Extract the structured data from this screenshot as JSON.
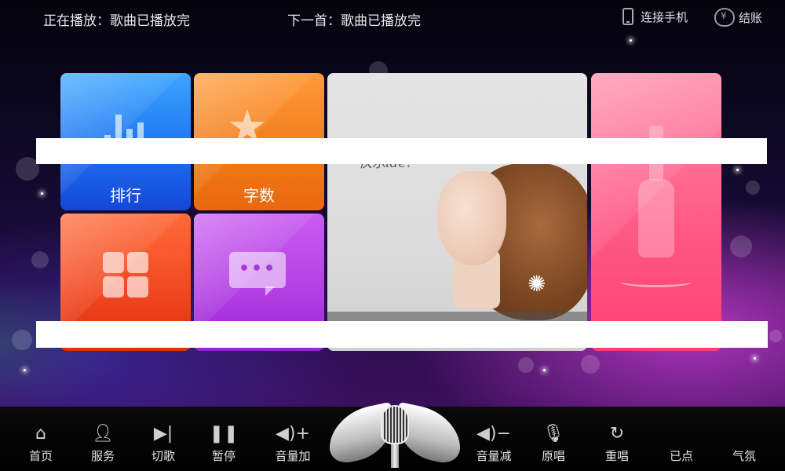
{
  "topbar": {
    "now_playing": "正在播放：歌曲已播放完",
    "next_song": "下一首：歌曲已播放完",
    "connect_phone": "连接手机",
    "checkout": "结账"
  },
  "tiles": {
    "rank_label": "排行",
    "count_label": "字数",
    "photo_script": "快乐ide?"
  },
  "controls": [
    {
      "label": "首页",
      "icon": "home-icon"
    },
    {
      "label": "服务",
      "icon": "person-icon"
    },
    {
      "label": "切歌",
      "icon": "skip-icon"
    },
    {
      "label": "暂停",
      "icon": "pause-icon"
    },
    {
      "label": "音量加",
      "icon": "volume-up-icon"
    },
    {
      "label": "音量减",
      "icon": "volume-down-icon"
    },
    {
      "label": "原唱",
      "icon": "mute-mic-icon"
    },
    {
      "label": "重唱",
      "icon": "replay-icon"
    },
    {
      "label": "已点",
      "icon": ""
    },
    {
      "label": "气氛",
      "icon": ""
    }
  ],
  "colors": {
    "rank_tile": "#2478f5",
    "count_tile": "#f07b17",
    "service_tile": "#f0461f",
    "message_tile": "#b13ee3",
    "pink_tile": "#ff5a86"
  }
}
